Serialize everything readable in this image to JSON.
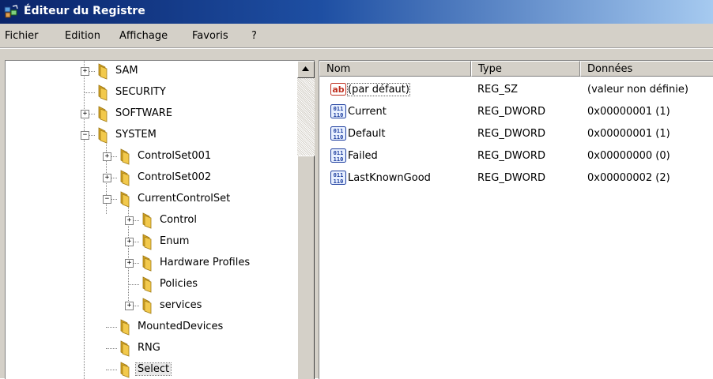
{
  "window": {
    "title": "Éditeur du Registre"
  },
  "menu": [
    "Fichier",
    "Edition",
    "Affichage",
    "Favoris",
    "?"
  ],
  "tree": [
    {
      "label": "SAM",
      "expander": "+"
    },
    {
      "label": "SECURITY",
      "expander": ""
    },
    {
      "label": "SOFTWARE",
      "expander": "+"
    },
    {
      "label": "SYSTEM",
      "expander": "−"
    },
    {
      "label": "ControlSet001",
      "expander": "+"
    },
    {
      "label": "ControlSet002",
      "expander": "+"
    },
    {
      "label": "CurrentControlSet",
      "expander": "−"
    },
    {
      "label": "Control",
      "expander": "+"
    },
    {
      "label": "Enum",
      "expander": "+"
    },
    {
      "label": "Hardware Profiles",
      "expander": "+"
    },
    {
      "label": "Policies",
      "expander": ""
    },
    {
      "label": "services",
      "expander": "+"
    },
    {
      "label": "MountedDevices",
      "expander": ""
    },
    {
      "label": "RNG",
      "expander": ""
    },
    {
      "label": "Select",
      "expander": "",
      "selected": true
    }
  ],
  "list": {
    "columns": [
      "Nom",
      "Type",
      "Données"
    ],
    "rows": [
      {
        "name": "(par défaut)",
        "type": "REG_SZ",
        "data": "(valeur non définie)",
        "icon": "string-value-icon"
      },
      {
        "name": "Current",
        "type": "REG_DWORD",
        "data": "0x00000001 (1)",
        "icon": "binary-value-icon"
      },
      {
        "name": "Default",
        "type": "REG_DWORD",
        "data": "0x00000001 (1)",
        "icon": "binary-value-icon"
      },
      {
        "name": "Failed",
        "type": "REG_DWORD",
        "data": "0x00000000 (0)",
        "icon": "binary-value-icon"
      },
      {
        "name": "LastKnownGood",
        "type": "REG_DWORD",
        "data": "0x00000002 (2)",
        "icon": "binary-value-icon"
      }
    ]
  },
  "icons": {
    "string_value_glyph": "ab",
    "binary_value_glyph": "011",
    "scroll_up": "scroll-up-arrow-icon"
  },
  "colors": {
    "titlebar_start": "#0a246a",
    "titlebar_end": "#a6caf0",
    "folder": "#f2c94c"
  }
}
